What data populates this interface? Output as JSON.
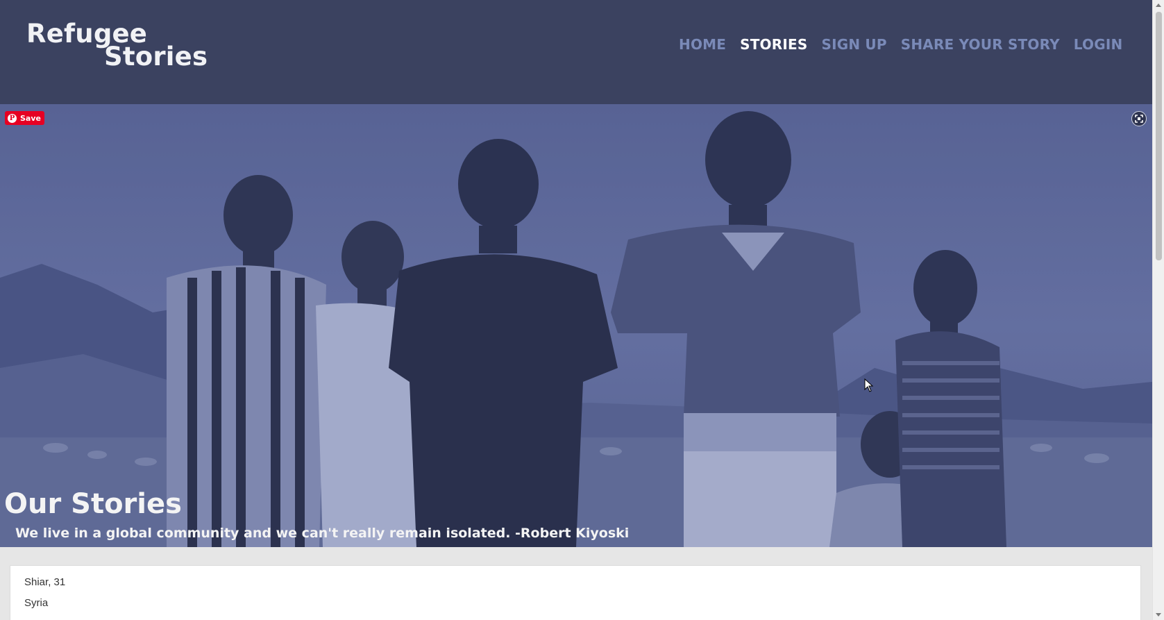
{
  "header": {
    "logo_line1": "Refugee",
    "logo_line2": "Stories",
    "nav": [
      {
        "label": "HOME",
        "active": false
      },
      {
        "label": "STORIES",
        "active": true
      },
      {
        "label": "SIGN UP",
        "active": false
      },
      {
        "label": "SHARE YOUR STORY",
        "active": false
      },
      {
        "label": "LOGIN",
        "active": false
      }
    ]
  },
  "hero": {
    "save_label": "Save",
    "title": "Our Stories",
    "quote": "We live in a global community and we can't really remain isolated. -Robert Kiyoski"
  },
  "story": {
    "name_age": "Shiar, 31",
    "country": "Syria"
  },
  "colors": {
    "header_bg": "#3b4260",
    "nav_inactive": "#7a8ab8",
    "nav_active": "#ffffff",
    "hero_tint": "#55619a",
    "pinterest": "#e60023"
  },
  "icons": {
    "save": "pinterest-icon",
    "fullscreen": "fullscreen-icon",
    "cursor": "mouse-pointer-icon"
  }
}
